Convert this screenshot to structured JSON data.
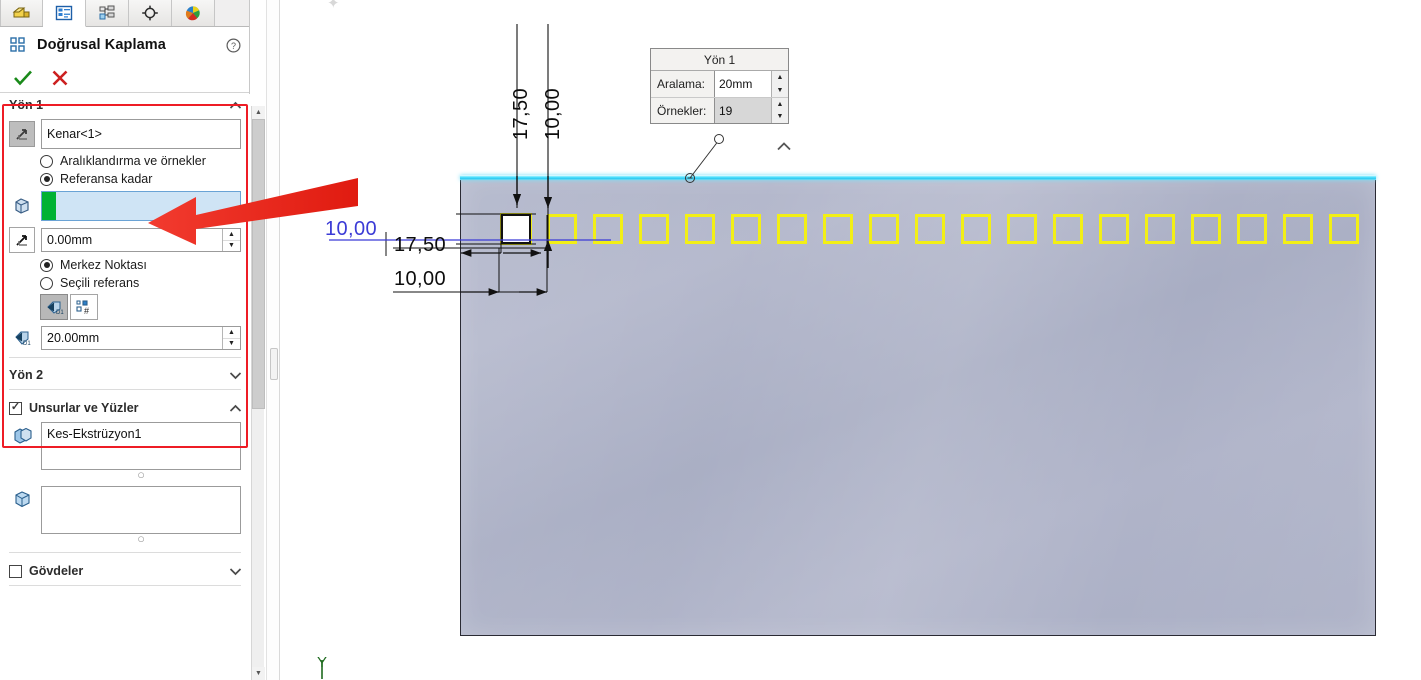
{
  "panel": {
    "tabs": [
      {
        "name": "feature-manager-tab",
        "icon": "part-tree-icon",
        "active": false
      },
      {
        "name": "property-manager-tab",
        "icon": "property-list-icon",
        "active": true
      },
      {
        "name": "configuration-manager-tab",
        "icon": "configuration-icon",
        "active": false
      },
      {
        "name": "display-manager-tab",
        "icon": "crosshair-icon",
        "active": false
      },
      {
        "name": "appearances-tab",
        "icon": "color-wheel-icon",
        "active": false
      }
    ],
    "title": "Doğrusal Kaplama",
    "title_icon": "linear-pattern-icon",
    "help_icon": "help-icon",
    "ok_label": "✓",
    "cancel_label": "✕",
    "accent_red": "#ee1c25",
    "accent_green": "#00b233",
    "accent_yellow": "#f2ef16",
    "accent_cyan": "#29c9f2"
  },
  "direction1": {
    "header": "Yön 1",
    "edge_icon": "direction-arrow-icon",
    "edge_value": "Kenar<1>",
    "radio_spacing_label": "Aralıklandırma ve örnekler",
    "radio_spacing_checked": false,
    "radio_uptoref_label": "Referansa kadar",
    "radio_uptoref_checked": true,
    "reference_icon": "reference-geometry-icon",
    "reference_value": "",
    "offset_icon": "offset-distance-icon",
    "offset_value": "0.00mm",
    "radio_centroid_label": "Merkez Noktası",
    "radio_centroid_checked": true,
    "radio_selected_ref_label": "Seçili referans",
    "radio_selected_ref_checked": false,
    "toggle_d1_icon": "offset-d1-icon",
    "toggle_d1_active": true,
    "toggle_instances_icon": "instance-count-icon",
    "toggle_instances_active": false,
    "spacing_icon": "spacing-d1-icon",
    "spacing_value": "20.00mm"
  },
  "direction2": {
    "header": "Yön 2"
  },
  "features_faces": {
    "header": "Unsurlar ve Yüzler",
    "checked": true,
    "feature_icon": "feature-cut-icon",
    "feature_value": "Kes-Ekstrüzyon1",
    "face_icon": "face-icon",
    "face_value": ""
  },
  "bodies": {
    "header": "Gövdeler",
    "checked": false
  },
  "flyout": {
    "title": "Yön 1",
    "spacing_label": "Aralama:",
    "spacing_value": "20mm",
    "instances_label": "Örnekler:",
    "instances_value": "19",
    "collapse_icon": "chevron-up-icon"
  },
  "dimensions": {
    "vertical_1": "17,50",
    "vertical_2": "10,00",
    "horizontal_1": "17,50",
    "horizontal_2": "10,00",
    "blue_callout": "10,00"
  },
  "viewport": {
    "axis_label": "Y",
    "pattern_count": 19,
    "seed_index": 0
  }
}
